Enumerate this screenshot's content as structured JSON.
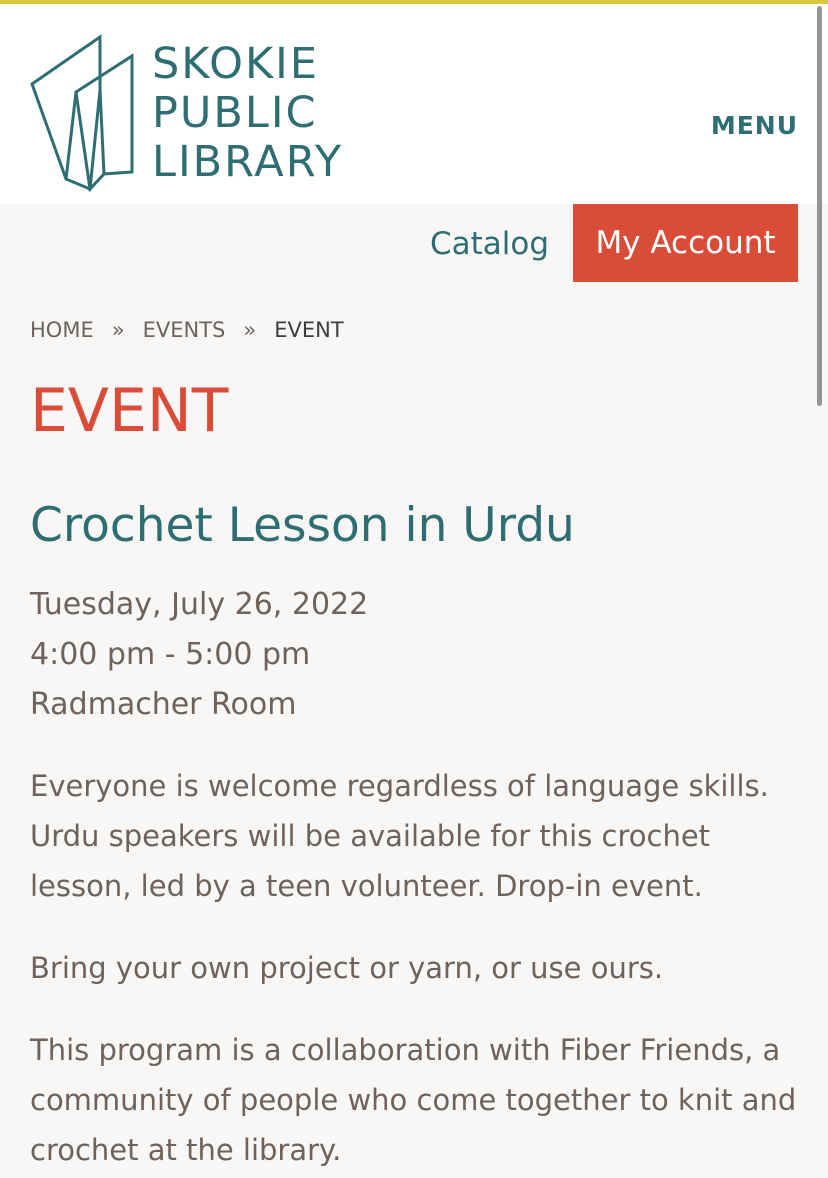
{
  "header": {
    "logo_lines": [
      "SKOKIE",
      "PUBLIC",
      "LIBRARY"
    ],
    "menu_label": "MENU"
  },
  "utility": {
    "catalog_label": "Catalog",
    "account_label": "My Account"
  },
  "breadcrumb": {
    "items": [
      "HOME",
      "EVENTS",
      "EVENT"
    ],
    "separator": "»"
  },
  "page_title": "EVENT",
  "event": {
    "title": "Crochet Lesson in Urdu",
    "date": "Tuesday, July 26, 2022",
    "time": "4:00 pm - 5:00 pm",
    "location": "Radmacher Room",
    "paragraphs": [
      "Everyone is welcome regardless of language skills. Urdu speakers will be available for this crochet lesson, led by a teen volunteer. Drop-in event.",
      "Bring your own project or yarn, or use ours.",
      "This program is a collaboration with Fiber Friends, a community of people who come together to knit and crochet at the library."
    ]
  },
  "colors": {
    "teal": "#2e6e73",
    "red": "#d94c38",
    "gold_bar": "#dcc63e",
    "body_text": "#6f625a"
  }
}
